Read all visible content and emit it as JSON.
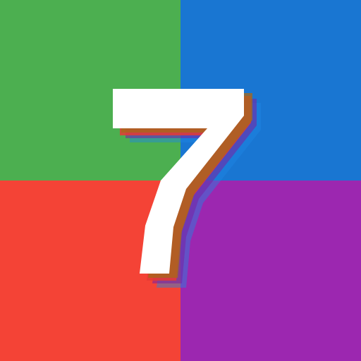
{
  "icon": {
    "glyph": "7",
    "colors": {
      "top_left": "#4CAF50",
      "top_right": "#1976D2",
      "bottom_left": "#F44336",
      "bottom_right": "#9C27B0",
      "glyph_main": "#FFFFFF",
      "shadow_red": "#F44336",
      "shadow_orange": "#E65100",
      "shadow_purple": "#7B1FA2",
      "shadow_blue": "#1E88E5"
    }
  }
}
